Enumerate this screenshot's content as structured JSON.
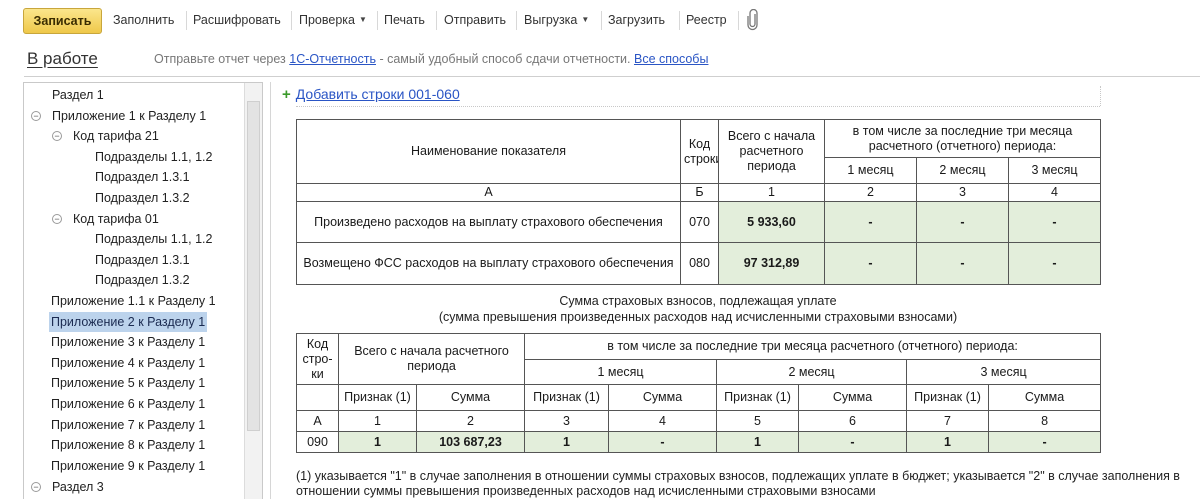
{
  "toolbar": {
    "save": "Записать",
    "fill": "Заполнить",
    "decode": "Расшифровать",
    "check": "Проверка",
    "print": "Печать",
    "send": "Отправить",
    "export": "Выгрузка",
    "load": "Загрузить",
    "registry": "Реестр"
  },
  "status": {
    "title": "В работе",
    "msg_before": "Отправьте отчет через ",
    "link": "1С-Отчетность",
    "msg_after": " - самый удобный способ сдачи отчетности. ",
    "all_ways": "Все способы"
  },
  "tree": {
    "items": [
      {
        "label": "Раздел 1"
      },
      {
        "label": "Приложение 1 к Разделу 1",
        "toggle": "⊖"
      },
      {
        "label": "Код тарифа 21",
        "toggle": "⊖"
      },
      {
        "label": "Подразделы 1.1, 1.2"
      },
      {
        "label": "Подраздел 1.3.1"
      },
      {
        "label": "Подраздел 1.3.2"
      },
      {
        "label": "Код тарифа 01",
        "toggle": "⊖"
      },
      {
        "label": "Подразделы 1.1, 1.2"
      },
      {
        "label": "Подраздел 1.3.1"
      },
      {
        "label": "Подраздел 1.3.2"
      },
      {
        "label": "Приложение 1.1 к Разделу 1"
      },
      {
        "label": "Приложение 2 к Разделу 1",
        "selected": true
      },
      {
        "label": "Приложение 3 к Разделу 1"
      },
      {
        "label": "Приложение 4 к Разделу 1"
      },
      {
        "label": "Приложение 5 к Разделу 1"
      },
      {
        "label": "Приложение 6 к Разделу 1"
      },
      {
        "label": "Приложение 7 к Разделу 1"
      },
      {
        "label": "Приложение 8 к Разделу 1"
      },
      {
        "label": "Приложение 9 к Разделу 1"
      },
      {
        "label": "Раздел 3",
        "toggle": "⊖"
      }
    ]
  },
  "add_rows": {
    "plus": "+",
    "label": "Добавить строки 001-060"
  },
  "table1": {
    "h_name": "Наименование показателя",
    "h_code": "Код строки",
    "h_total": "Всего с начала расчетного периода",
    "h_months": "в том числе за последние три месяца расчетного (отчетного) периода:",
    "m1": "1 месяц",
    "m2": "2 месяц",
    "m3": "3 месяц",
    "n_a": "А",
    "n_b": "Б",
    "n_1": "1",
    "n_2": "2",
    "n_3": "3",
    "n_4": "4",
    "rows": [
      {
        "name": "Произведено расходов на выплату страхового обеспечения",
        "code": "070",
        "total": "5 933,60",
        "m1": "-",
        "m2": "-",
        "m3": "-"
      },
      {
        "name": "Возмещено ФСС расходов на выплату страхового обеспечения",
        "code": "080",
        "total": "97 312,89",
        "m1": "-",
        "m2": "-",
        "m3": "-"
      }
    ]
  },
  "caption": {
    "line1": "Сумма страховых взносов, подлежащая уплате",
    "line2": "(сумма превышения произведенных расходов над исчисленными страховыми взносами)"
  },
  "table2": {
    "h_code": "Код стро-ки",
    "h_total": "Всего с начала расчетного периода",
    "h_months": "в том числе за последние три месяца расчетного (отчетного) периода:",
    "m1": "1 месяц",
    "m2": "2 месяц",
    "m3": "3 месяц",
    "sign": "Признак (1)",
    "sum": "Сумма",
    "nums": [
      "А",
      "1",
      "2",
      "3",
      "4",
      "5",
      "6",
      "7",
      "8"
    ],
    "row": {
      "code": "090",
      "s0": "1",
      "v0": "103 687,23",
      "s1": "1",
      "v1": "-",
      "s2": "1",
      "v2": "-",
      "s3": "1",
      "v3": "-"
    }
  },
  "footnote": "(1) указывается \"1\" в случае заполнения в отношении суммы страховых взносов, подлежащих уплате в бюджет; указывается \"2\" в случае заполнения в отношении суммы превышения произведенных расходов над исчисленными страховыми взносами"
}
